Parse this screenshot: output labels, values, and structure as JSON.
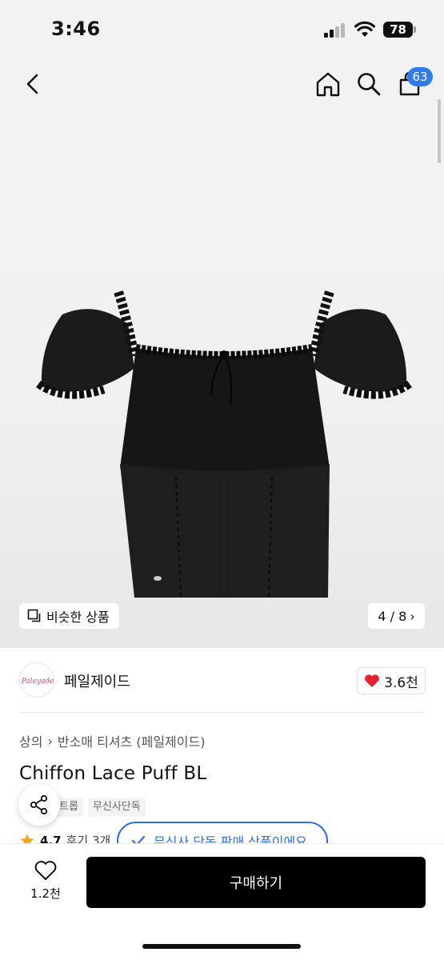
{
  "status_bar": {
    "time": "3:46",
    "battery": "78"
  },
  "nav": {
    "cart_count": "63"
  },
  "gallery": {
    "similar_label": "비슷한 상품",
    "page": "4 / 8",
    "page_arrow": "›"
  },
  "brand": {
    "name": "페일제이드",
    "logo_text": "Paleyade",
    "likes": "3.6천"
  },
  "breadcrumb": {
    "category": "상의",
    "separator": "›",
    "subcategory": "반소매 티셔츠 (페일제이드)"
  },
  "product": {
    "title": "Chiffon Lace Puff BL"
  },
  "tags": [
    "트롭",
    "무신사단독"
  ],
  "rating": {
    "score": "4.7",
    "reviews": "후기 3개"
  },
  "exclusive_notice": "무신사 단독 판매 상품이에요",
  "bottom": {
    "wish_count": "1.2천",
    "buy_label": "구매하기"
  },
  "colors": {
    "accent_blue": "#2f7cf0",
    "heart_red": "#e8212e",
    "buy_button": "#000000"
  },
  "icons": [
    "back-icon",
    "home-icon",
    "search-icon",
    "shopping-bag-icon",
    "similar-icon",
    "heart-icon",
    "share-icon",
    "star-icon",
    "check-icon"
  ]
}
